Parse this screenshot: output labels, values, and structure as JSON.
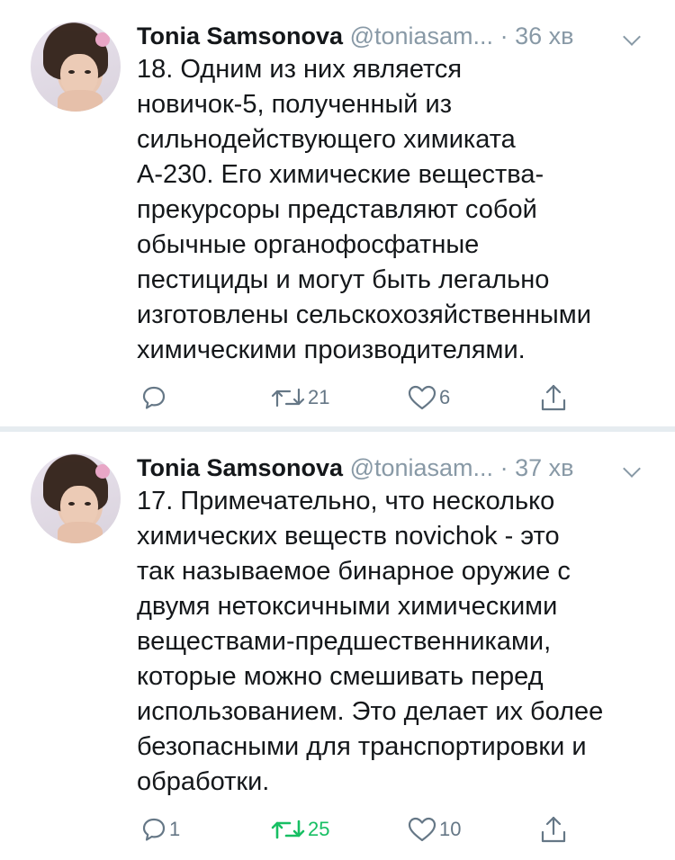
{
  "tweets": [
    {
      "name": "Tonia Samsonova",
      "handle": "@toniasam...",
      "separator": "·",
      "time": "36 хв",
      "lines": [
        "18.  Одним из них является",
        "новичок-5, полученный из",
        "сильнодействующего химиката",
        "А-230. Его химические вещества-",
        "прекурсоры представляют собой",
        "обычные органофосфатные",
        "пестициды и могут быть легально",
        "изготовлены сельскохозяйственными",
        "химическими производителями."
      ],
      "reply_count": "",
      "retweet_count": "21",
      "like_count": "6",
      "retweeted": false
    },
    {
      "name": "Tonia Samsonova",
      "handle": "@toniasam...",
      "separator": "·",
      "time": "37 хв",
      "lines": [
        "17. Примечательно, что несколько",
        "химических веществ novichok - это",
        "так называемое бинарное оружие с",
        "двумя нетоксичными химическими",
        "веществами-предшественниками,",
        "которые можно смешивать перед",
        "использованием. Это делает их более",
        "безопасными для транспортировки и",
        "обработки."
      ],
      "reply_count": "1",
      "retweet_count": "25",
      "like_count": "10",
      "retweeted": true
    }
  ],
  "colors": {
    "text": "#14171a",
    "secondary": "#8899a6",
    "icon": "#657786",
    "retweet_active": "#17bf63",
    "divider": "#e6ecf0"
  },
  "icons": {
    "reply": "reply-icon",
    "retweet": "retweet-icon",
    "like": "heart-icon",
    "share": "share-icon",
    "more": "chevron-down-icon"
  }
}
